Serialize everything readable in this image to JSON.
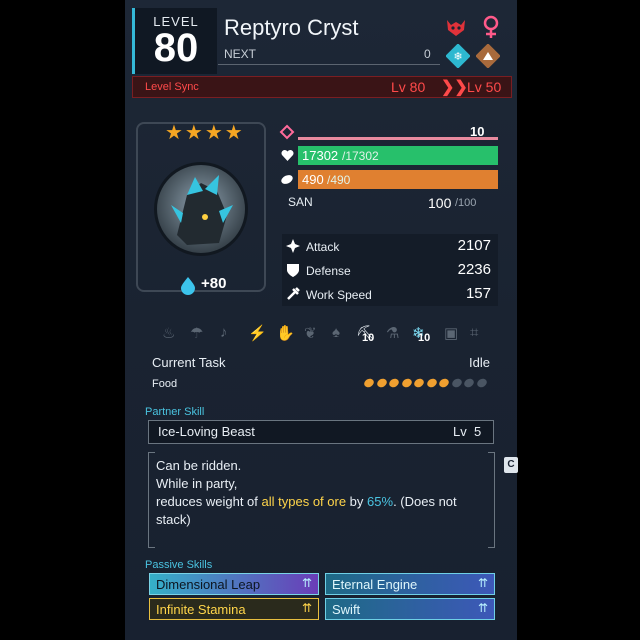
{
  "header": {
    "level_label": "LEVEL",
    "level_value": "80",
    "pal_name": "Reptyro Cryst",
    "next_label": "NEXT",
    "next_value": "0"
  },
  "level_sync": {
    "label": "Level Sync",
    "from": "Lv 80",
    "to": "Lv 50"
  },
  "portrait": {
    "stars": "★★★★",
    "condense_label": "+80"
  },
  "stats": {
    "trust_value": "10",
    "hp_current": "17302",
    "hp_max": "/17302",
    "sp_current": "490",
    "sp_max": "/490",
    "san_label": "SAN",
    "san_current": "100",
    "san_max": "/100",
    "attack_label": "Attack",
    "attack_value": "2107",
    "defense_label": "Defense",
    "defense_value": "2236",
    "workspeed_label": "Work Speed",
    "workspeed_value": "157"
  },
  "work": {
    "mining_level": "10",
    "cooling_level": "10",
    "current_task_label": "Current Task",
    "current_task_value": "Idle",
    "food_label": "Food",
    "food_total": 10,
    "food_filled": 7
  },
  "partner_skill": {
    "section_title": "Partner Skill",
    "name": "Ice-Loving Beast",
    "level": "Lv  5",
    "desc_line1": "Can be ridden.",
    "desc_line2": "While in party,",
    "desc_line3a": "reduces weight of ",
    "desc_line3b": "all types of ore",
    "desc_line3c": " by ",
    "desc_line3d": "65%",
    "desc_line3e": ". (Does not",
    "desc_line4": "stack)"
  },
  "passive_skills": {
    "section_title": "Passive Skills",
    "items": [
      {
        "name": "Dimensional Leap"
      },
      {
        "name": "Eternal Engine"
      },
      {
        "name": "Infinite Stamina"
      },
      {
        "name": "Swift"
      }
    ]
  },
  "colors": {
    "accent": "#35b9d8",
    "hp": "#27c06b",
    "sp": "#e08030",
    "sync": "#ff4a4a",
    "gold": "#ffd54a"
  }
}
